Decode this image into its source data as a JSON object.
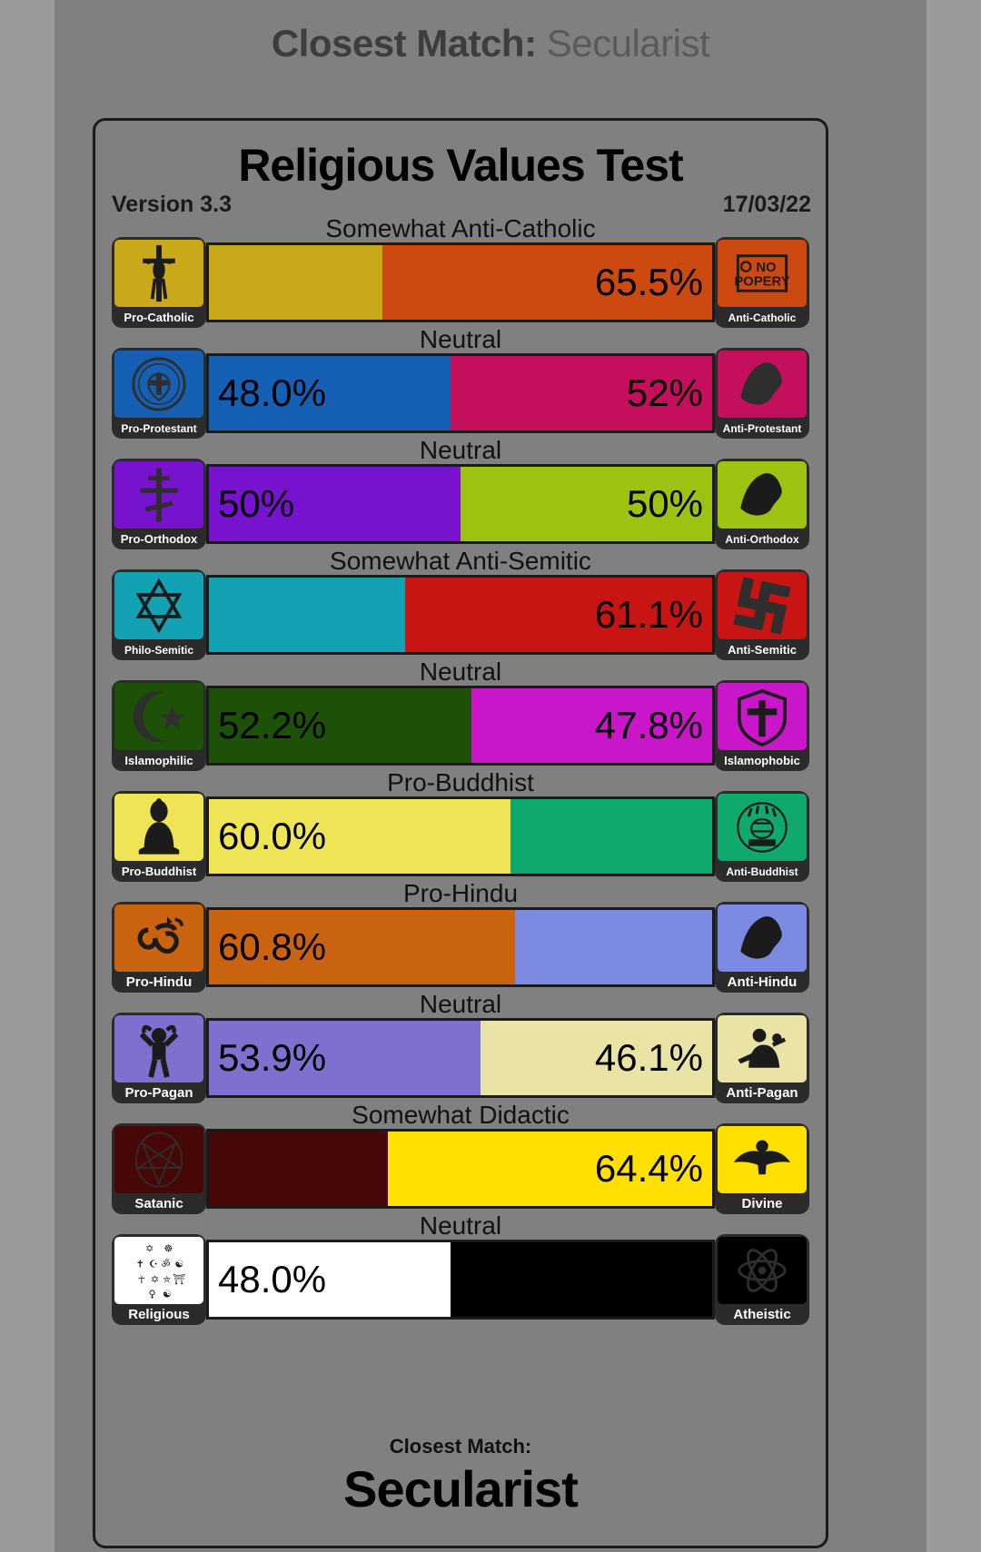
{
  "header": {
    "prefix": "Closest Match:",
    "match": "Secularist"
  },
  "card": {
    "title": "Religious Values Test",
    "version": "Version 3.3",
    "date": "17/03/22",
    "footer_label": "Closest Match:",
    "footer_match": "Secularist"
  },
  "colors": {
    "page_bg": "#9a9a9a",
    "app_bg": "#808080",
    "chip_bg": "#2b2b2b",
    "outline": "#1b1b1b"
  },
  "chart_data": {
    "type": "bar",
    "title": "Religious Values Test",
    "subtitle": "Version 3.3 / 17/03/22",
    "orientation": "horizontal-diverging",
    "xlim": [
      0,
      100
    ],
    "grid": false,
    "legend": "none",
    "axes": [
      {
        "caption": "Somewhat Anti-Catholic",
        "left_label": "Pro-Catholic",
        "right_label": "Anti-Catholic",
        "left_value": 34.5,
        "right_value": 65.5,
        "left_display": "",
        "right_display": "65.5%",
        "left_color": "#c9a81a",
        "right_color": "#cc4a11",
        "left_icon": "crucifix-icon",
        "right_icon": "no-popery-sign-icon"
      },
      {
        "caption": "Neutral",
        "left_label": "Pro-Protestant",
        "right_label": "Anti-Protestant",
        "left_value": 48.0,
        "right_value": 52.0,
        "left_display": "48.0%",
        "right_display": "52%",
        "left_color": "#1560b4",
        "right_color": "#c4105c",
        "left_icon": "luther-rose-icon",
        "right_icon": "map-silhouette-icon"
      },
      {
        "caption": "Neutral",
        "left_label": "Pro-Orthodox",
        "right_label": "Anti-Orthodox",
        "left_value": 50.0,
        "right_value": 50.0,
        "left_display": "50%",
        "right_display": "50%",
        "left_color": "#7712cf",
        "right_color": "#9ec211",
        "left_icon": "orthodox-cross-icon",
        "right_icon": "map-silhouette-icon"
      },
      {
        "caption": "Somewhat Anti-Semitic",
        "left_label": "Philo-Semitic",
        "right_label": "Anti-Semitic",
        "left_value": 38.9,
        "right_value": 61.1,
        "left_display": "",
        "right_display": "61.1%",
        "left_color": "#13a2b4",
        "right_color": "#c91414",
        "left_icon": "star-of-david-icon",
        "right_icon": "swastika-icon"
      },
      {
        "caption": "Neutral",
        "left_label": "Islamophilic",
        "right_label": "Islamophobic",
        "left_value": 52.2,
        "right_value": 47.8,
        "left_display": "52.2%",
        "right_display": "47.8%",
        "left_color": "#1d5107",
        "right_color": "#c916c9",
        "left_icon": "star-and-crescent-icon",
        "right_icon": "crusader-shield-icon"
      },
      {
        "caption": "Pro-Buddhist",
        "left_label": "Pro-Buddhist",
        "right_label": "Anti-Buddhist",
        "left_value": 60.0,
        "right_value": 40.0,
        "left_display": "60.0%",
        "right_display": "",
        "left_color": "#efe356",
        "right_color": "#10a96d",
        "left_icon": "seated-buddha-icon",
        "right_icon": "deity-relief-icon"
      },
      {
        "caption": "Pro-Hindu",
        "left_label": "Pro-Hindu",
        "right_label": "Anti-Hindu",
        "left_value": 60.8,
        "right_value": 39.2,
        "left_display": "60.8%",
        "right_display": "",
        "left_color": "#c96310",
        "right_color": "#7b8ae0",
        "left_icon": "om-icon",
        "right_icon": "map-silhouette-icon"
      },
      {
        "caption": "Neutral",
        "left_label": "Pro-Pagan",
        "right_label": "Anti-Pagan",
        "left_value": 53.9,
        "right_value": 46.1,
        "left_display": "53.9%",
        "right_display": "46.1%",
        "left_color": "#7e70cf",
        "right_color": "#eae3a6",
        "left_icon": "horned-figure-icon",
        "right_icon": "statue-relief-icon"
      },
      {
        "caption": "Somewhat Didactic",
        "left_label": "Satanic",
        "right_label": "Divine",
        "left_value": 35.6,
        "right_value": 64.4,
        "left_display": "",
        "right_display": "64.4%",
        "left_color": "#470707",
        "right_color": "#ffe000",
        "left_icon": "pentagram-icon",
        "right_icon": "eagle-icon"
      },
      {
        "caption": "Neutral",
        "left_label": "Religious",
        "right_label": "Atheistic",
        "left_value": 48.0,
        "right_value": 52.0,
        "left_display": "48.0%",
        "right_display": "",
        "left_color": "#ffffff",
        "right_color": "#000000",
        "left_icon": "world-religions-symbols-icon",
        "right_icon": "atheist-atom-icon"
      }
    ]
  }
}
